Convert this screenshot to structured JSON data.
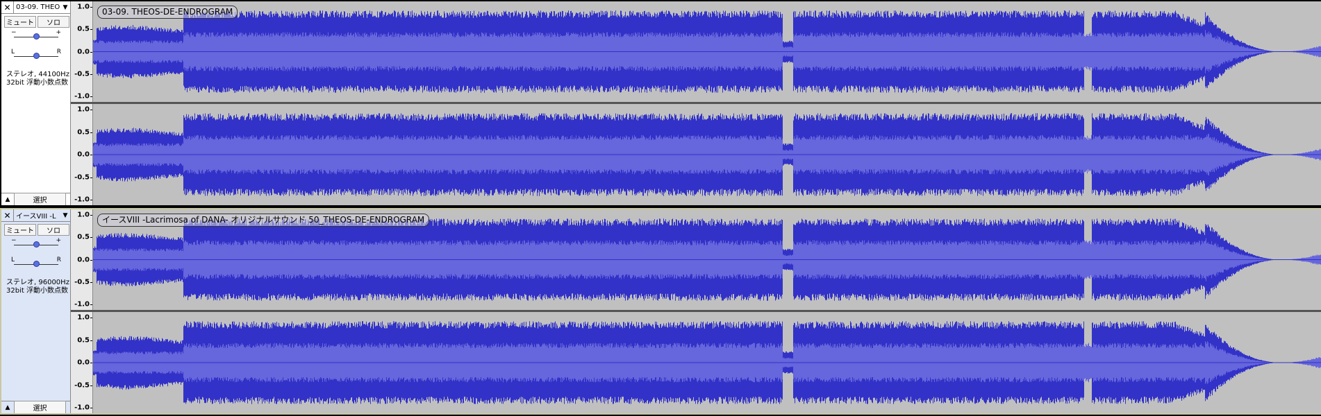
{
  "colors": {
    "waveform_dark": "#3232c8",
    "waveform_rms": "#6666dd",
    "background": "#c0c0c0",
    "selected_border": "#c8c8a0"
  },
  "tracks": [
    {
      "track_name": "03-09. THEO",
      "clip_name": "03-09. THEOS-DE-ENDROGRAM",
      "mute_label": "ミュート",
      "solo_label": "ソロ",
      "gain_minus": "−",
      "gain_plus": "+",
      "pan_left": "L",
      "pan_right": "R",
      "format_line1": "ステレオ, 44100Hz",
      "format_line2": "32bit 浮動小数点数",
      "select_label": "選択",
      "gain_value": 0.5,
      "pan_value": 0.5,
      "close_icon": "close-icon",
      "menu_icon": "chevron-down-icon",
      "collapse_icon": "collapse-icon"
    },
    {
      "track_name": "イースVIII -L",
      "clip_name": "イースVIII -Lacrimosa of DANA- オリジナルサウンド 50_THEOS-DE-ENDROGRAM",
      "mute_label": "ミュート",
      "solo_label": "ソロ",
      "gain_minus": "−",
      "gain_plus": "+",
      "pan_left": "L",
      "pan_right": "R",
      "format_line1": "ステレオ, 96000Hz",
      "format_line2": "32bit 浮動小数点数",
      "select_label": "選択",
      "gain_value": 0.5,
      "pan_value": 0.5,
      "close_icon": "close-icon",
      "menu_icon": "chevron-down-icon",
      "collapse_icon": "collapse-icon"
    }
  ],
  "ruler_labels": [
    "1.0",
    "0.5",
    "0.0",
    "-0.5",
    "-1.0"
  ],
  "ruler_values": [
    1.0,
    0.5,
    0.0,
    -0.5,
    -1.0
  ]
}
